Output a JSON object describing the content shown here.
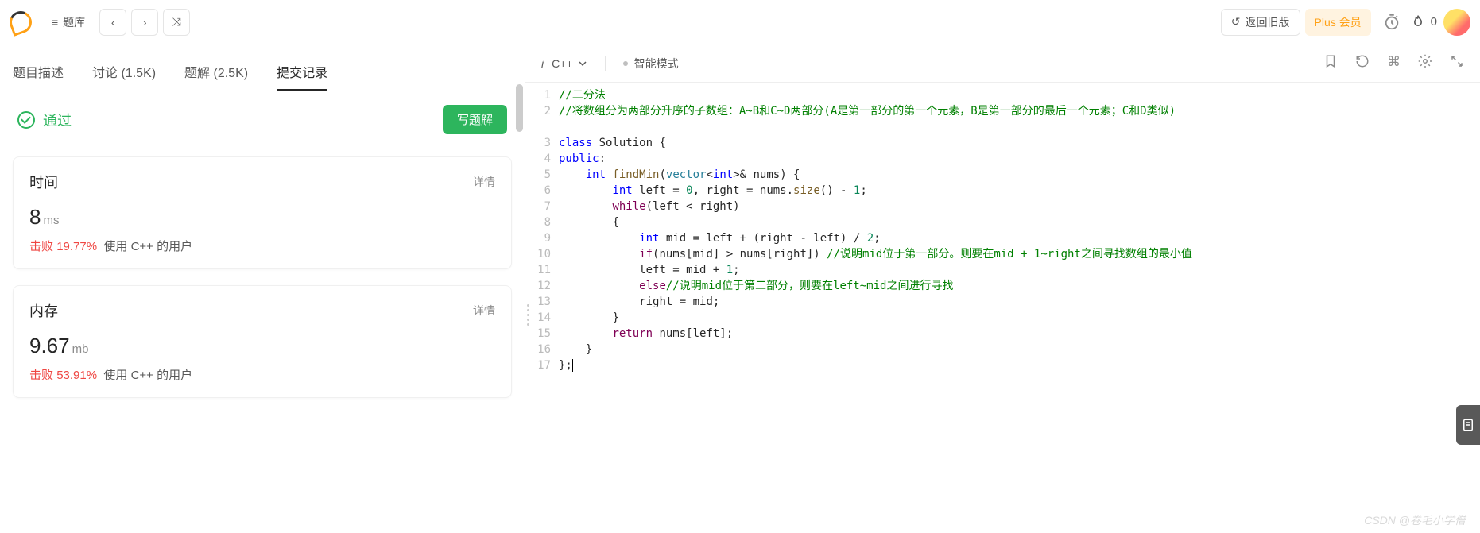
{
  "topbar": {
    "problems_label": "题库",
    "back_old_label": "返回旧版",
    "plus_label": "Plus 会员",
    "streak_count": "0"
  },
  "tabs": {
    "desc": "题目描述",
    "discuss": "讨论 (1.5K)",
    "solution": "题解 (2.5K)",
    "submit": "提交记录"
  },
  "result": {
    "status": "通过",
    "write_btn": "写题解"
  },
  "time_card": {
    "title": "时间",
    "detail": "详情",
    "value": "8",
    "unit": "ms",
    "beat_prefix": "击败",
    "beat_pct": "19.77%",
    "beat_suffix": "使用 C++ 的用户"
  },
  "mem_card": {
    "title": "内存",
    "detail": "详情",
    "value": "9.67",
    "unit": "mb",
    "beat_prefix": "击败",
    "beat_pct": "53.91%",
    "beat_suffix": "使用 C++ 的用户"
  },
  "editor": {
    "lang_prefix": "i",
    "lang": "C++",
    "smart_mode": "智能模式"
  },
  "code": {
    "l1": "//二分法",
    "l2": "//将数组分为两部分升序的子数组：A~B和C~D两部分(A是第一部分的第一个元素，B是第一部分的最后一个元素；C和D类似)",
    "l3_kw": "class",
    "l3_name": " Solution {",
    "l4_kw": "public",
    "l4_rest": ":",
    "l5_int": "int",
    "l5_fn": " findMin",
    "l5_vec": "vector",
    "l5_int2": "int",
    "l5_rest": ">& nums) {",
    "l6_int": "int",
    "l6_a": " left = ",
    "l6_z": "0",
    "l6_b": ", right = nums.",
    "l6_size": "size",
    "l6_c": "() - ",
    "l6_one": "1",
    "l6_d": ";",
    "l7_kw": "while",
    "l7_rest": "(left < right)",
    "l8": "{",
    "l9_int": "int",
    "l9_a": " mid = left + (right - left) / ",
    "l9_two": "2",
    "l9_b": ";",
    "l10_if": "if",
    "l10_a": "(nums[mid] > nums[right]) ",
    "l10_c": "//说明mid位于第一部分。则要在mid + 1~right之间寻找数组的最小值",
    "l11_a": "left = mid + ",
    "l11_one": "1",
    "l11_b": ";",
    "l12_else": "else",
    "l12_c": "//说明mid位于第二部分，则要在left~mid之间进行寻找",
    "l13": "right = mid;",
    "l14": "}",
    "l15_ret": "return",
    "l15_rest": " nums[left];",
    "l16": "}",
    "l17": "};"
  },
  "watermark": "CSDN @卷毛小学僧"
}
